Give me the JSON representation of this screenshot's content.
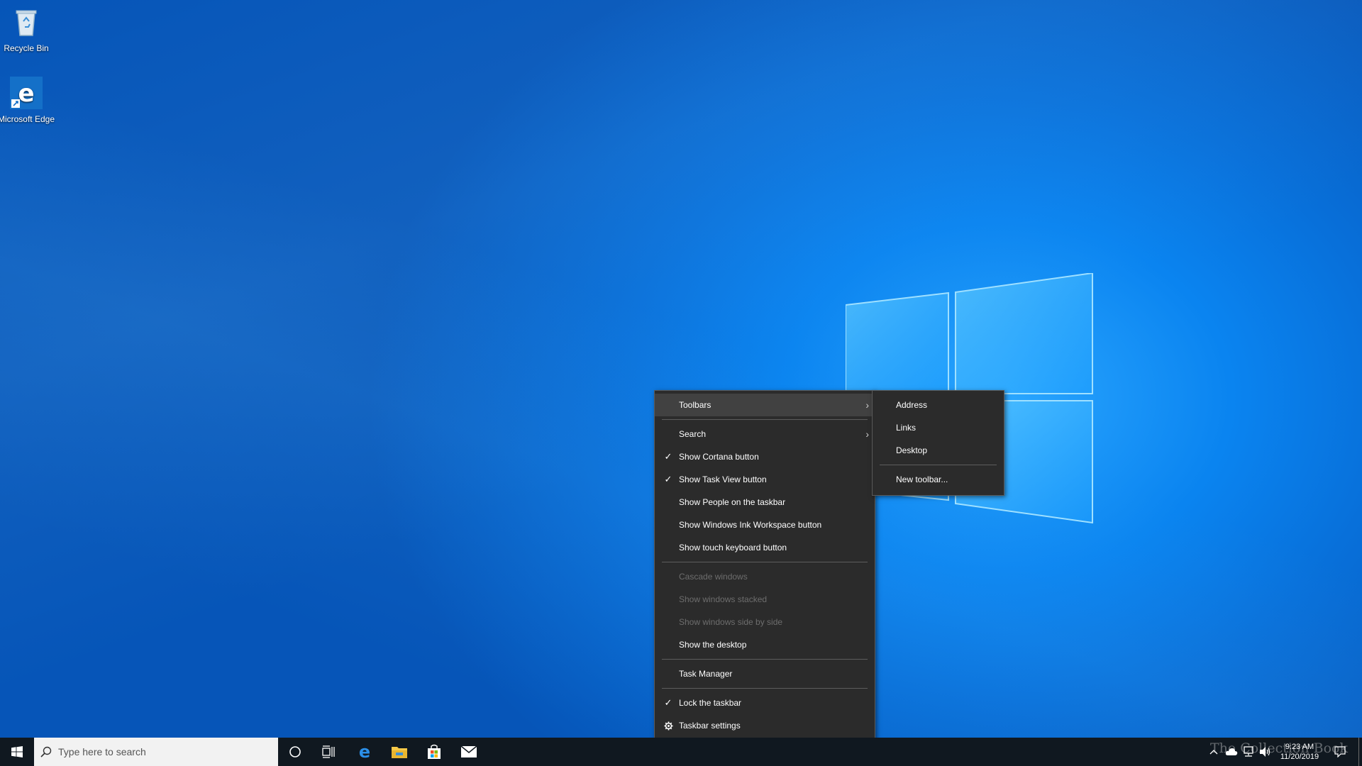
{
  "desktop": {
    "icons": [
      {
        "label": "Recycle Bin",
        "icon": "recycle-bin-icon"
      },
      {
        "label": "Microsoft Edge",
        "icon": "edge-icon"
      }
    ]
  },
  "context_menu": {
    "items": [
      {
        "label": "Toolbars",
        "submenu": true,
        "highlighted": true
      },
      {
        "label": "Search",
        "submenu": true
      },
      {
        "label": "Show Cortana button",
        "checked": true
      },
      {
        "label": "Show Task View button",
        "checked": true
      },
      {
        "label": "Show People on the taskbar"
      },
      {
        "label": "Show Windows Ink Workspace button"
      },
      {
        "label": "Show touch keyboard button"
      },
      {
        "label": "Cascade windows",
        "disabled": true
      },
      {
        "label": "Show windows stacked",
        "disabled": true
      },
      {
        "label": "Show windows side by side",
        "disabled": true
      },
      {
        "label": "Show the desktop"
      },
      {
        "label": "Task Manager"
      },
      {
        "label": "Lock the taskbar",
        "checked": true
      },
      {
        "label": "Taskbar settings",
        "icon": "gear-icon"
      }
    ],
    "check_glyph": "✓",
    "arrow_glyph": "›"
  },
  "toolbars_submenu": {
    "items": [
      {
        "label": "Address"
      },
      {
        "label": "Links"
      },
      {
        "label": "Desktop"
      },
      {
        "label": "New toolbar..."
      }
    ]
  },
  "taskbar": {
    "search_placeholder": "Type here to search",
    "pinned": [
      "cortana-icon",
      "task-view-icon",
      "edge-icon",
      "file-explorer-icon",
      "store-icon",
      "mail-icon"
    ],
    "clock": {
      "time": "9:23 AM",
      "date": "11/20/2019"
    }
  },
  "watermark": "The Collection Book",
  "colors": {
    "menu_bg": "#2b2b2b",
    "menu_highlight": "#414141",
    "taskbar_bg": "#101820",
    "desktop_accent": "#0a84f0"
  }
}
